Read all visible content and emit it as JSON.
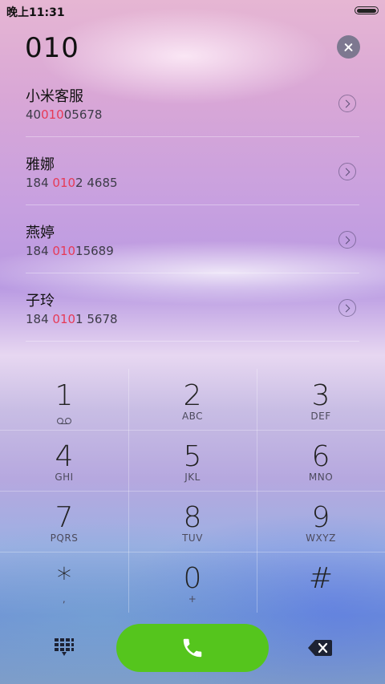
{
  "status_bar": {
    "time": "晚上11:31"
  },
  "dial": {
    "query": "010"
  },
  "results": [
    {
      "name": "小米客服",
      "pre": "40",
      "match": "010",
      "post": "05678"
    },
    {
      "name": "雅娜",
      "pre": "184 ",
      "match": "010",
      "post": "2 4685"
    },
    {
      "name": "燕婷",
      "pre": "184 ",
      "match": "010",
      "post": "15689"
    },
    {
      "name": "子玲",
      "pre": "184 ",
      "match": "010",
      "post": "1 5678"
    }
  ],
  "keypad": {
    "k1": {
      "digit": "1",
      "letters": ""
    },
    "k2": {
      "digit": "2",
      "letters": "ABC"
    },
    "k3": {
      "digit": "3",
      "letters": "DEF"
    },
    "k4": {
      "digit": "4",
      "letters": "GHI"
    },
    "k5": {
      "digit": "5",
      "letters": "JKL"
    },
    "k6": {
      "digit": "6",
      "letters": "MNO"
    },
    "k7": {
      "digit": "7",
      "letters": "PQRS"
    },
    "k8": {
      "digit": "8",
      "letters": "TUV"
    },
    "k9": {
      "digit": "9",
      "letters": "WXYZ"
    },
    "kstar": {
      "digit": "*",
      "letters": ","
    },
    "k0": {
      "digit": "0",
      "letters": "+"
    },
    "khash": {
      "digit": "#",
      "letters": ""
    }
  },
  "icons": {
    "voicemail": "voicemail-icon",
    "call": "phone-icon",
    "dialpad": "dialpad-icon",
    "backspace": "backspace-icon",
    "clear": "clear-icon",
    "detail": "chevron-right-icon"
  },
  "colors": {
    "highlight": "#e63a56",
    "call_button": "#55c51d"
  }
}
